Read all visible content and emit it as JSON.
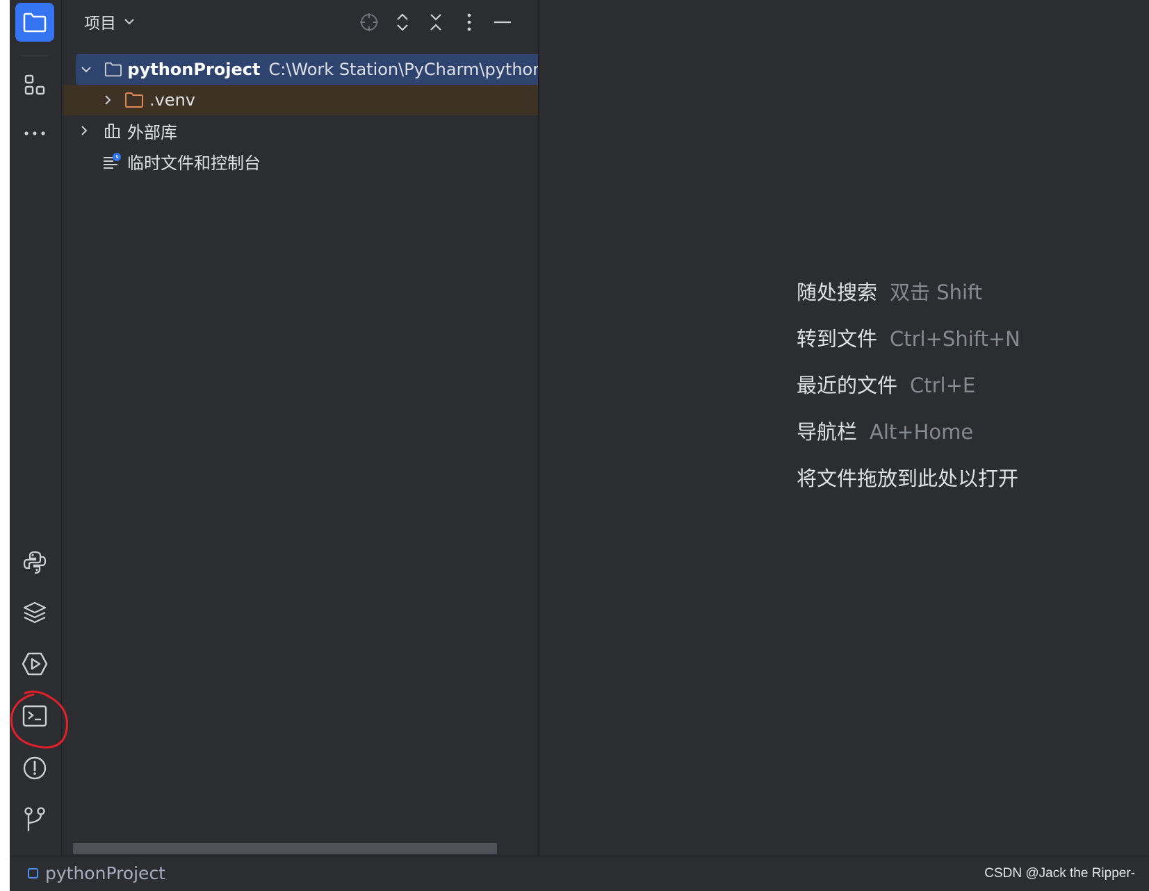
{
  "panel": {
    "title": "项目",
    "toolbar": [
      "locate-icon",
      "expand-all-icon",
      "collapse-all-icon",
      "more-icon",
      "minimize-icon"
    ]
  },
  "tree": {
    "root": {
      "name": "pythonProject",
      "path": "C:\\Work Station\\PyCharm\\pythonPr"
    },
    "venv": ".venv",
    "external_libs": "外部库",
    "scratches": "临时文件和控制台"
  },
  "editor_hints": [
    {
      "label": "随处搜索",
      "shortcut": "双击 Shift"
    },
    {
      "label": "转到文件",
      "shortcut": "Ctrl+Shift+N"
    },
    {
      "label": "最近的文件",
      "shortcut": "Ctrl+E"
    },
    {
      "label": "导航栏",
      "shortcut": "Alt+Home"
    },
    {
      "label": "将文件拖放到此处以打开",
      "shortcut": ""
    }
  ],
  "status": {
    "project": "pythonProject",
    "watermark": "CSDN @Jack the Ripper-"
  },
  "colors": {
    "accent": "#3574f0",
    "folder_venv": "#e08855",
    "annotation": "#e0202a"
  }
}
